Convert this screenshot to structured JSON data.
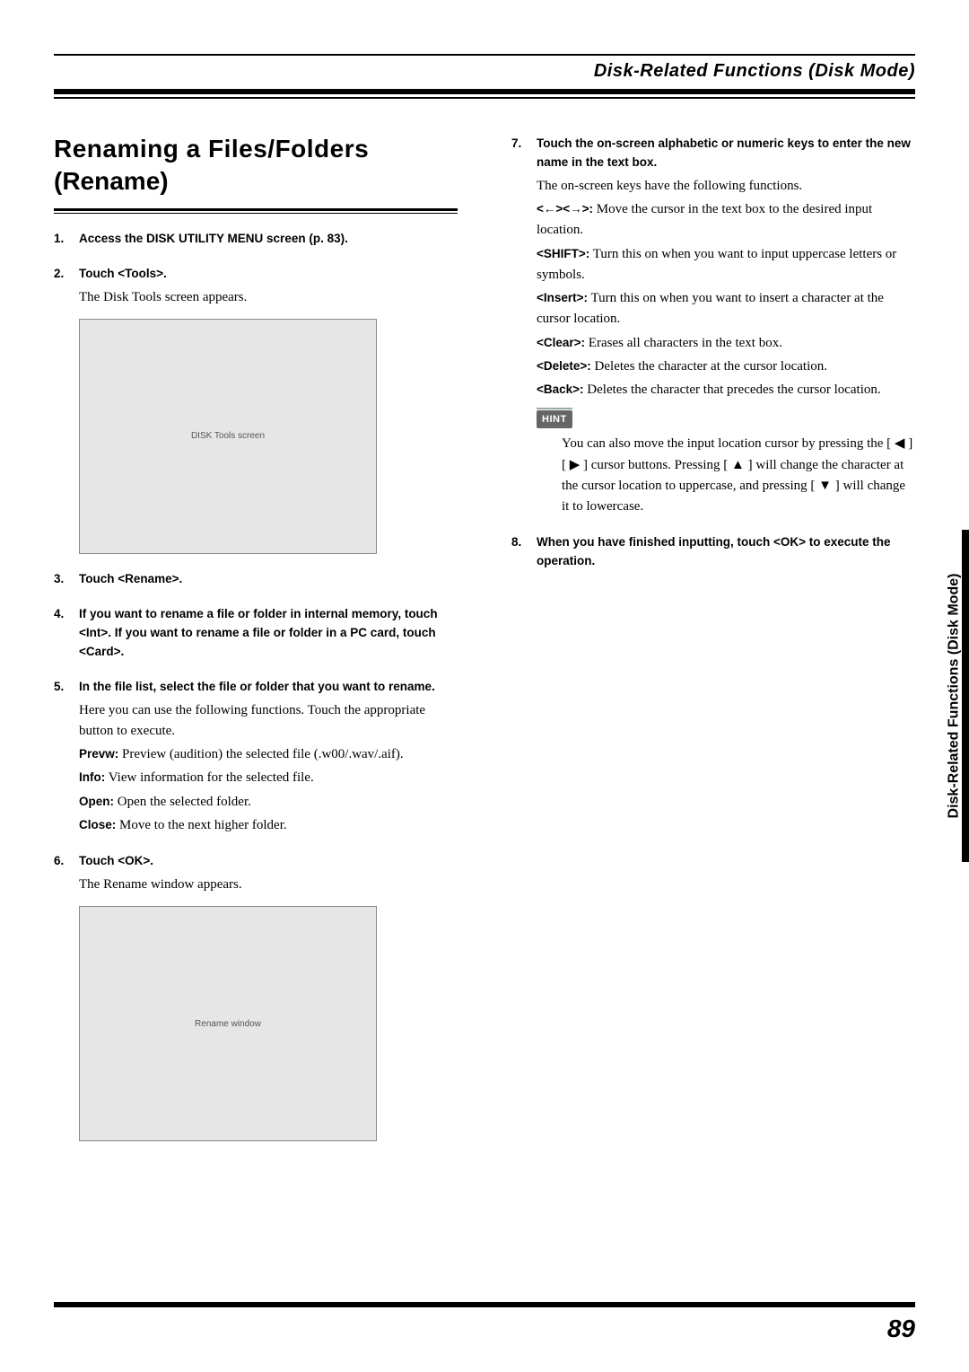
{
  "header": {
    "title": "Disk-Related Functions (Disk Mode)"
  },
  "side_tab": "Disk-Related Functions (Disk Mode)",
  "page_number": "89",
  "section": {
    "title_line1": "Renaming a Files/Folders",
    "title_line2": "(Rename)"
  },
  "left_steps": [
    {
      "head": "Access the DISK UTILITY MENU screen (p. 83).",
      "body": []
    },
    {
      "head": "Touch <Tools>.",
      "body": [
        {
          "text": "The Disk Tools screen appears."
        }
      ],
      "has_screenshot": true,
      "screenshot_label": "DISK Tools screen"
    },
    {
      "head": "Touch <Rename>.",
      "body": []
    },
    {
      "head": "If you want to rename a file or folder in internal memory, touch <Int>. If you want to rename a file or folder in a PC card, touch <Card>.",
      "body": []
    },
    {
      "head": "In the file list, select the file or folder that you want to rename.",
      "body": [
        {
          "text": "Here you can use the following functions. Touch the appropriate button to execute."
        },
        {
          "b": "Prevw:",
          "text": " Preview (audition) the selected file (.w00/.wav/.aif)."
        },
        {
          "b": "Info:",
          "text": " View information for the selected file."
        },
        {
          "b": "Open:",
          "text": " Open the selected folder."
        },
        {
          "b": "Close:",
          "text": " Move to the next higher folder."
        }
      ]
    },
    {
      "head": "Touch <OK>.",
      "body": [
        {
          "text": "The Rename window appears."
        }
      ],
      "has_screenshot": true,
      "screenshot_label": "Rename window"
    }
  ],
  "right_steps": [
    {
      "head": "Touch the on-screen alphabetic or numeric keys to enter the new name in the text box.",
      "body": [
        {
          "text": "The on-screen keys have the following functions."
        },
        {
          "b": "<←><→>:",
          "text": " Move the cursor in the text box to the desired input location."
        },
        {
          "b": "<SHIFT>:",
          "text": " Turn this on when you want to input uppercase letters or symbols."
        },
        {
          "b": "<Insert>:",
          "text": " Turn this on when you want to insert a character at the cursor location."
        },
        {
          "b": "<Clear>:",
          "text": " Erases all characters in the text box."
        },
        {
          "b": "<Delete>:",
          "text": " Deletes the character at the cursor location."
        },
        {
          "b": "<Back>:",
          "text": " Deletes the character that precedes the cursor location."
        }
      ],
      "hint": {
        "label": "HINT",
        "text": "You can also move the input location cursor by pressing the [ ◀ ][ ▶ ] cursor buttons. Pressing [ ▲ ] will change the character at the cursor location to uppercase, and pressing [ ▼ ] will change it to lowercase."
      }
    },
    {
      "head": "When you have finished inputting, touch <OK> to execute the operation.",
      "body": []
    }
  ]
}
